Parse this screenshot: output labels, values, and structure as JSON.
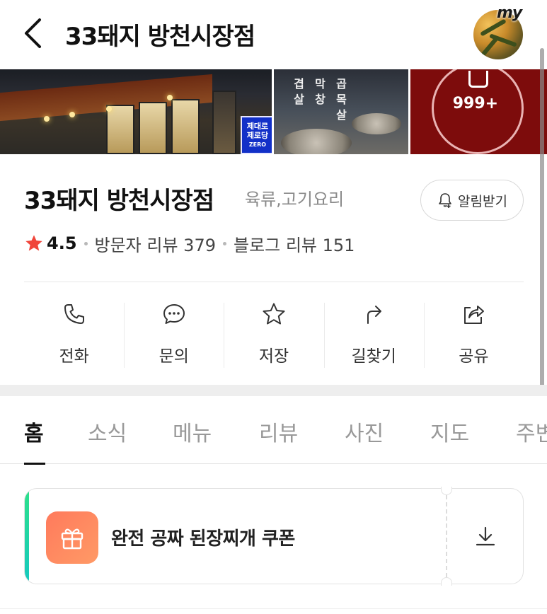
{
  "header": {
    "title": "33돼지 방천시장점",
    "my_badge": "my"
  },
  "photos": {
    "more_count": "999+",
    "signboard_text": "제대로 제로당",
    "signboard_sub": "ZERO",
    "p2_letters_1": "겹살",
    "p2_letters_2": "막창",
    "p2_letters_3": "곱목살"
  },
  "place": {
    "name": "33돼지 방천시장점",
    "category": "육류,고기요리",
    "notify_label": "알림받기",
    "rating": "4.5",
    "visitor_review": "방문자 리뷰 379",
    "blog_review": "블로그 리뷰 151"
  },
  "actions": [
    {
      "label": "전화",
      "icon": "phone-icon"
    },
    {
      "label": "문의",
      "icon": "chat-icon"
    },
    {
      "label": "저장",
      "icon": "star-outline-icon"
    },
    {
      "label": "길찾기",
      "icon": "directions-icon"
    },
    {
      "label": "공유",
      "icon": "share-icon"
    }
  ],
  "tabs": [
    {
      "label": "홈",
      "active": true
    },
    {
      "label": "소식"
    },
    {
      "label": "메뉴"
    },
    {
      "label": "리뷰"
    },
    {
      "label": "사진"
    },
    {
      "label": "지도"
    },
    {
      "label": "주변"
    }
  ],
  "coupon": {
    "title": "완전 공짜 된장찌개 쿠폰"
  },
  "colors": {
    "star": "#f0453a",
    "coupon_accent": "#1fd6a6",
    "gift_bg": "#ff8a60",
    "photo_red": "#7d0c0c"
  }
}
